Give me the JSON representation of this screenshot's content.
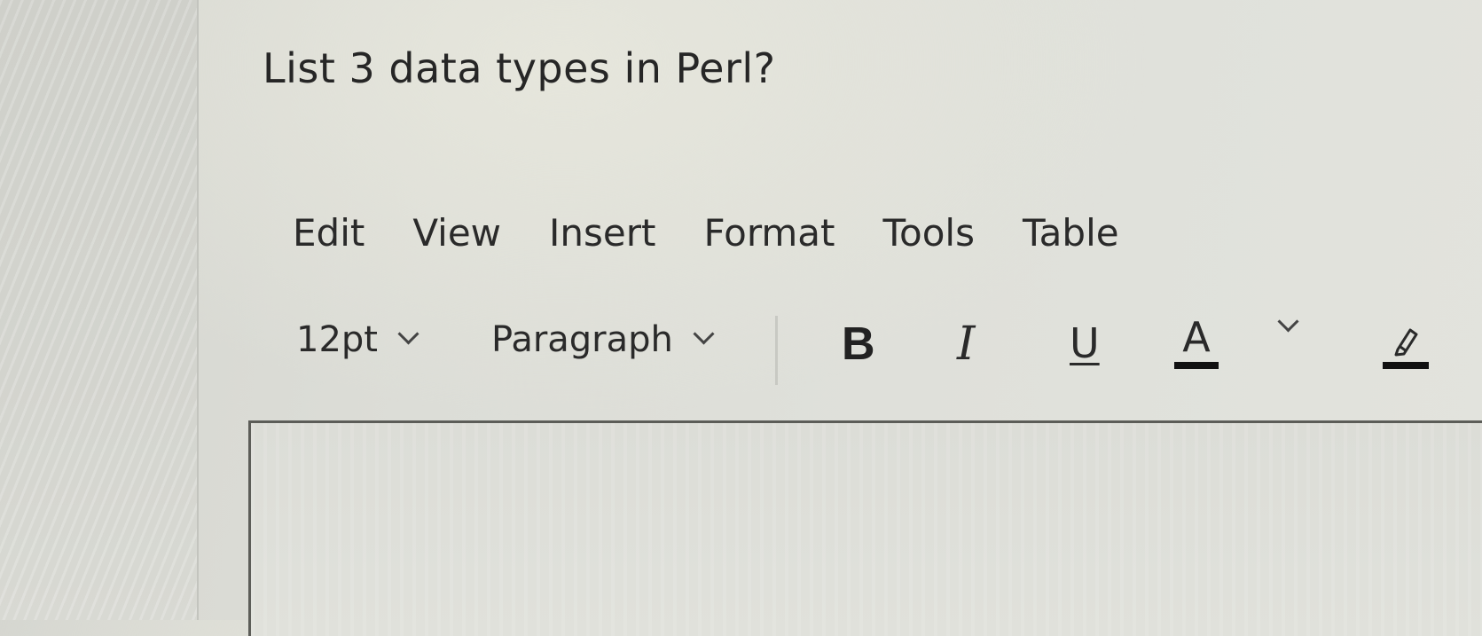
{
  "question": {
    "text": "List 3 data types in Perl?"
  },
  "menubar": {
    "items": [
      "Edit",
      "View",
      "Insert",
      "Format",
      "Tools",
      "Table"
    ]
  },
  "toolbar": {
    "font_size": "12pt",
    "block_format": "Paragraph",
    "bold_label": "B",
    "italic_label": "I",
    "underline_label": "U",
    "text_color_label": "A",
    "text_color_value": "#111111",
    "highlight_color_value": "#111111",
    "icons": [
      "chevron-down-icon",
      "bold-icon",
      "italic-icon",
      "underline-icon",
      "text-color-icon",
      "highlight-pen-icon"
    ]
  },
  "editor": {
    "content": ""
  }
}
